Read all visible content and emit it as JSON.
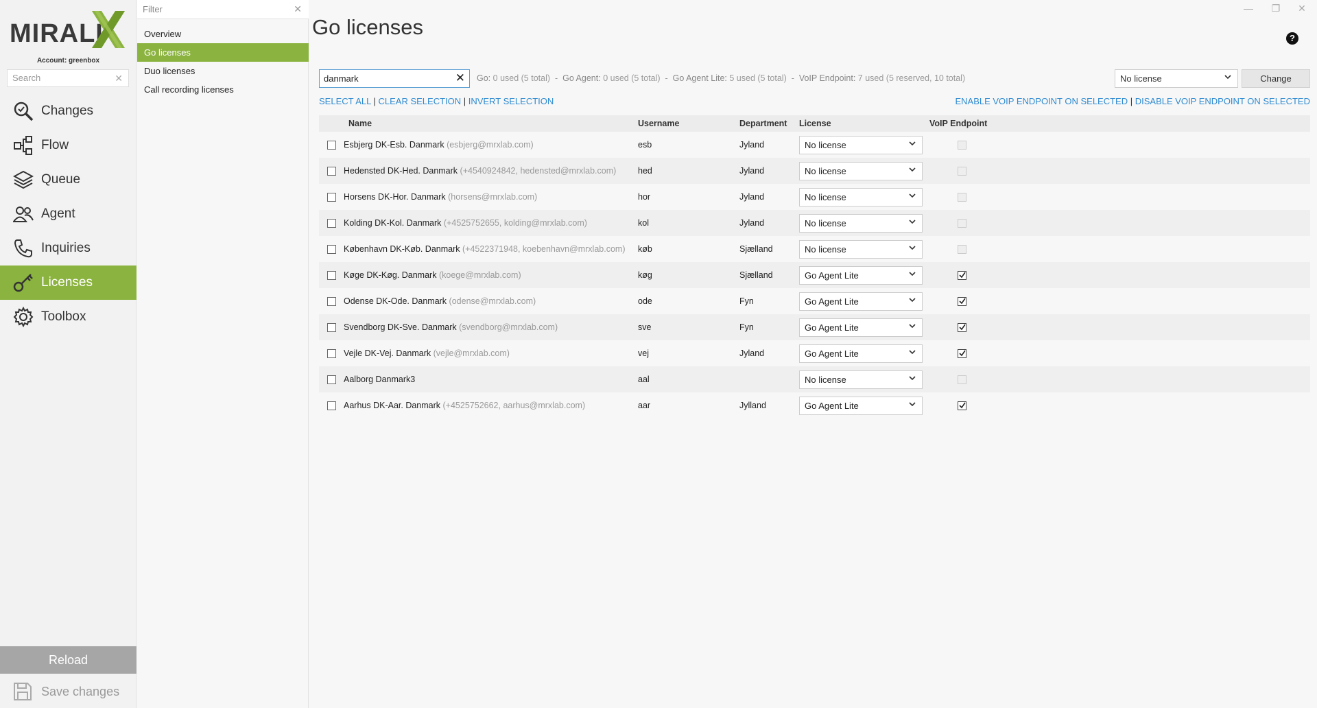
{
  "brand": {
    "logo_text": "MIRALI",
    "account": "Account: greenbox",
    "accent": "#8bb33f"
  },
  "nav": {
    "search_placeholder": "Search",
    "items": [
      {
        "label": "Changes",
        "icon": "search-changes-icon"
      },
      {
        "label": "Flow",
        "icon": "flow-icon"
      },
      {
        "label": "Queue",
        "icon": "layers-icon"
      },
      {
        "label": "Agent",
        "icon": "agents-icon"
      },
      {
        "label": "Inquiries",
        "icon": "phone-icon"
      },
      {
        "label": "Licenses",
        "icon": "key-icon",
        "active": true
      },
      {
        "label": "Toolbox",
        "icon": "gear-icon"
      }
    ],
    "reload": "Reload",
    "save": "Save changes"
  },
  "subnav": {
    "filter_placeholder": "Filter",
    "items": [
      {
        "label": "Overview"
      },
      {
        "label": "Go licenses",
        "active": true
      },
      {
        "label": "Duo licenses"
      },
      {
        "label": "Call recording licenses"
      }
    ]
  },
  "main": {
    "title": "Go licenses",
    "search_value": "danmark",
    "usage": {
      "go_label": "Go:",
      "go_value": "0 used (5 total)",
      "agent_label": "Go Agent:",
      "agent_value": "0 used (5 total)",
      "lite_label": "Go Agent Lite:",
      "lite_value": "5 used (5 total)",
      "voip_label": "VoIP Endpoint:",
      "voip_value": "7 used (5 reserved, 10 total)"
    },
    "license_select": "No license",
    "change_button": "Change",
    "select_all": "SELECT ALL",
    "clear_selection": "CLEAR SELECTION",
    "invert_selection": "INVERT SELECTION",
    "enable_voip": "ENABLE VOIP ENDPOINT ON SELECTED",
    "disable_voip": "DISABLE VOIP ENDPOINT ON SELECTED",
    "columns": {
      "name": "Name",
      "username": "Username",
      "department": "Department",
      "license": "License",
      "voip": "VoIP Endpoint"
    },
    "rows": [
      {
        "name": "Esbjerg DK-Esb. Danmark",
        "detail": "(esbjerg@mrxlab.com)",
        "username": "esb",
        "department": "Jyland",
        "license": "No license",
        "voip": false
      },
      {
        "name": "Hedensted DK-Hed. Danmark",
        "detail": "(+4540924842, hedensted@mrxlab.com)",
        "username": "hed",
        "department": "Jyland",
        "license": "No license",
        "voip": false
      },
      {
        "name": "Horsens DK-Hor. Danmark",
        "detail": "(horsens@mrxlab.com)",
        "username": "hor",
        "department": "Jyland",
        "license": "No license",
        "voip": false
      },
      {
        "name": "Kolding DK-Kol. Danmark",
        "detail": "(+4525752655, kolding@mrxlab.com)",
        "username": "kol",
        "department": "Jyland",
        "license": "No license",
        "voip": false
      },
      {
        "name": "København DK-Køb. Danmark",
        "detail": "(+4522371948, koebenhavn@mrxlab.com)",
        "username": "køb",
        "department": "Sjælland",
        "license": "No license",
        "voip": false
      },
      {
        "name": "Køge DK-Køg. Danmark",
        "detail": "(koege@mrxlab.com)",
        "username": "køg",
        "department": "Sjælland",
        "license": "Go Agent Lite",
        "voip": true
      },
      {
        "name": "Odense DK-Ode. Danmark",
        "detail": "(odense@mrxlab.com)",
        "username": "ode",
        "department": "Fyn",
        "license": "Go Agent Lite",
        "voip": true
      },
      {
        "name": "Svendborg DK-Sve. Danmark",
        "detail": "(svendborg@mrxlab.com)",
        "username": "sve",
        "department": "Fyn",
        "license": "Go Agent Lite",
        "voip": true
      },
      {
        "name": "Vejle DK-Vej. Danmark",
        "detail": "(vejle@mrxlab.com)",
        "username": "vej",
        "department": "Jyland",
        "license": "Go Agent Lite",
        "voip": true
      },
      {
        "name": "Aalborg Danmark3",
        "detail": "",
        "username": "aal",
        "department": "",
        "license": "No license",
        "voip": false
      },
      {
        "name": "Aarhus DK-Aar. Danmark",
        "detail": "(+4525752662, aarhus@mrxlab.com)",
        "username": "aar",
        "department": "Jylland",
        "license": "Go Agent Lite",
        "voip": true
      }
    ]
  }
}
